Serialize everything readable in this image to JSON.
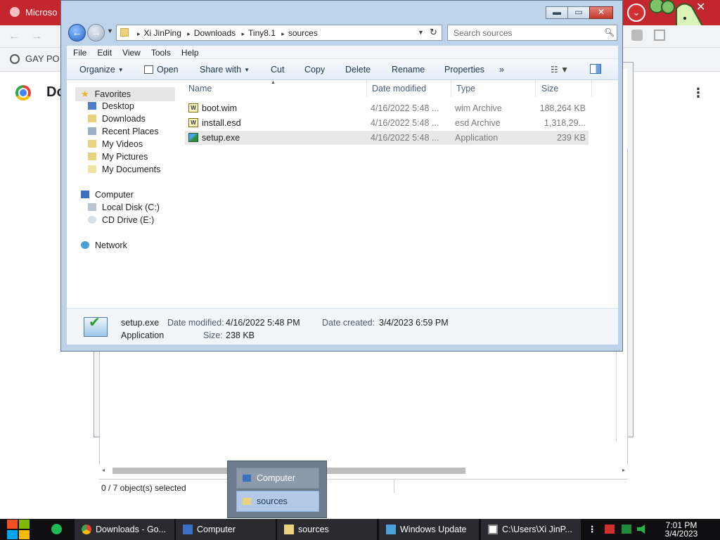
{
  "chrome": {
    "tab_title": "Microso",
    "bookmark_label": "GAY PO",
    "page_title": "Do",
    "back_arrow": "←",
    "forward_arrow": "→",
    "kebab": "⋮",
    "menu_circle": "⌄",
    "close": "✕"
  },
  "back_window": {
    "status_text": "0 / 7 object(s) selected"
  },
  "explorer": {
    "title_buttons": {
      "minimize": "▬",
      "maximize": "▭",
      "close": "✕"
    },
    "nav": {
      "back": "←",
      "forward": "→",
      "history": "▼"
    },
    "breadcrumb": [
      "Xi JinPing",
      "Downloads",
      "Tiny8.1",
      "sources"
    ],
    "breadcrumb_sep": "▸",
    "search_placeholder": "Search sources",
    "menu": [
      "File",
      "Edit",
      "View",
      "Tools",
      "Help"
    ],
    "commands": {
      "organize": "Organize",
      "open": "Open",
      "share_with": "Share with",
      "cut": "Cut",
      "copy": "Copy",
      "delete": "Delete",
      "rename": "Rename",
      "properties": "Properties",
      "more": "»"
    },
    "nav_pane": {
      "favorites": "Favorites",
      "favorites_items": [
        "Desktop",
        "Downloads",
        "Recent Places",
        "My Videos",
        "My Pictures",
        "My Documents"
      ],
      "computer": "Computer",
      "computer_items": [
        "Local Disk (C:)",
        "CD Drive (E:)"
      ],
      "network": "Network"
    },
    "columns": {
      "name": "Name",
      "date": "Date modified",
      "type": "Type",
      "size": "Size"
    },
    "files": [
      {
        "name": "boot.wim",
        "date": "4/16/2022 5:48 ...",
        "type": "wim Archive",
        "size": "188,264 KB",
        "icon": "archive-icon"
      },
      {
        "name": "install.esd",
        "date": "4/16/2022 5:48 ...",
        "type": "esd Archive",
        "size": "1,318,29...",
        "icon": "archive-icon"
      },
      {
        "name": "setup.exe",
        "date": "4/16/2022 5:48 ...",
        "type": "Application",
        "size": "239 KB",
        "icon": "setup-icon"
      }
    ],
    "details": {
      "name": "setup.exe",
      "kind": "Application",
      "modified_label": "Date modified:",
      "modified_value": "4/16/2022 5:48 PM",
      "size_label": "Size:",
      "size_value": "238 KB",
      "created_label": "Date created:",
      "created_value": "3/4/2023 6:59 PM"
    }
  },
  "peek": {
    "items": [
      "Computer",
      "sources"
    ]
  },
  "taskbar": {
    "items": [
      {
        "label": "Downloads - Go...",
        "icon": "chrome-icon"
      },
      {
        "label": "Computer",
        "icon": "computer-icon"
      },
      {
        "label": "sources",
        "icon": "folder-icon"
      },
      {
        "label": "Windows Update",
        "icon": "windows-update-icon"
      },
      {
        "label": "C:\\Users\\Xi JinP...",
        "icon": "7zip-icon"
      }
    ],
    "overflow": "⋮",
    "time": "7:01 PM",
    "date": "3/4/2023"
  },
  "colors": {
    "chrome_red": "#c3262c",
    "taskbar": "#0f0f12",
    "explorer_frame": "#bcd3ea",
    "selected_row": "#e8e8e8"
  }
}
